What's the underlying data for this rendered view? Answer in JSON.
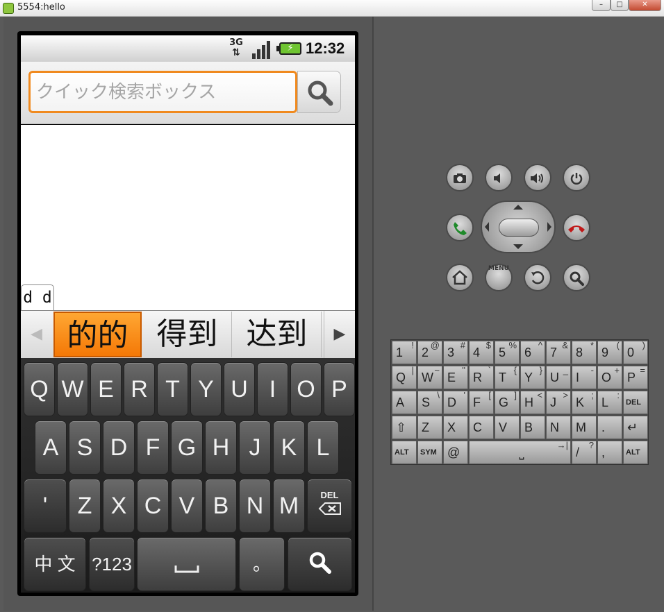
{
  "window": {
    "title": "5554:hello",
    "min": "–",
    "max": "□",
    "close": "✕"
  },
  "status_bar": {
    "network": "3G",
    "clock": "12:32",
    "signal_level": 1.0,
    "battery_charging": true
  },
  "search": {
    "placeholder": "クイック検索ボックス",
    "value": ""
  },
  "compose_text": "d d",
  "candidates": {
    "items": [
      "的的",
      "得到",
      "达到"
    ],
    "selected": 0,
    "prev_label": "◀",
    "next_label": "▶"
  },
  "soft_keyboard": {
    "row1": [
      "Q",
      "W",
      "E",
      "R",
      "T",
      "Y",
      "U",
      "I",
      "O",
      "P"
    ],
    "row2": [
      "A",
      "S",
      "D",
      "F",
      "G",
      "H",
      "J",
      "K",
      "L"
    ],
    "row3": [
      "'",
      "Z",
      "X",
      "C",
      "V",
      "B",
      "N",
      "M"
    ],
    "del_label": "DEL",
    "lang_label": "中 文",
    "sym_label": "?123",
    "space_label": "␣",
    "period_label": "。",
    "search_icon": "search-icon"
  },
  "hw_buttons": {
    "camera": "camera-icon",
    "vol_down": "volume-down-icon",
    "vol_up": "volume-up-icon",
    "power": "power-icon",
    "call": "call-icon",
    "end_call": "end-call-icon",
    "home": "home-icon",
    "menu_label": "MENU",
    "back": "back-icon",
    "search": "search-icon"
  },
  "hw_keyboard": {
    "row1": [
      {
        "k": "1",
        "a": "!"
      },
      {
        "k": "2",
        "a": "@"
      },
      {
        "k": "3",
        "a": "#"
      },
      {
        "k": "4",
        "a": "$"
      },
      {
        "k": "5",
        "a": "%"
      },
      {
        "k": "6",
        "a": "^"
      },
      {
        "k": "7",
        "a": "&"
      },
      {
        "k": "8",
        "a": "*"
      },
      {
        "k": "9",
        "a": "("
      },
      {
        "k": "0",
        "a": ")"
      }
    ],
    "row2": [
      {
        "k": "Q",
        "a": "|"
      },
      {
        "k": "W",
        "a": "~"
      },
      {
        "k": "E",
        "a": "\""
      },
      {
        "k": "R",
        "a": "`"
      },
      {
        "k": "T",
        "a": "{"
      },
      {
        "k": "Y",
        "a": "}"
      },
      {
        "k": "U",
        "a": "_"
      },
      {
        "k": "I",
        "a": "-"
      },
      {
        "k": "O",
        "a": "+"
      },
      {
        "k": "P",
        "a": "="
      }
    ],
    "row3": [
      {
        "k": "A",
        "a": ""
      },
      {
        "k": "S",
        "a": "\\"
      },
      {
        "k": "D",
        "a": "'"
      },
      {
        "k": "F",
        "a": "["
      },
      {
        "k": "G",
        "a": "]"
      },
      {
        "k": "H",
        "a": "<"
      },
      {
        "k": "J",
        "a": ">"
      },
      {
        "k": "K",
        "a": ";"
      },
      {
        "k": "L",
        "a": ":"
      },
      {
        "k": "DEL",
        "a": ""
      }
    ],
    "row4": [
      {
        "k": "⇧",
        "a": ""
      },
      {
        "k": "Z",
        "a": ""
      },
      {
        "k": "X",
        "a": ""
      },
      {
        "k": "C",
        "a": ""
      },
      {
        "k": "V",
        "a": ""
      },
      {
        "k": "B",
        "a": ""
      },
      {
        "k": "N",
        "a": ""
      },
      {
        "k": "M",
        "a": ""
      },
      {
        "k": ".",
        "a": ""
      },
      {
        "k": "↵",
        "a": ""
      }
    ],
    "row5": [
      {
        "k": "ALT",
        "a": ""
      },
      {
        "k": "SYM",
        "a": ""
      },
      {
        "k": "@",
        "a": ""
      },
      {
        "k": "⎵",
        "a": "→|"
      },
      {
        "k": "/",
        "a": "?"
      },
      {
        "k": ",",
        "a": ""
      },
      {
        "k": "ALT",
        "a": ""
      }
    ]
  }
}
